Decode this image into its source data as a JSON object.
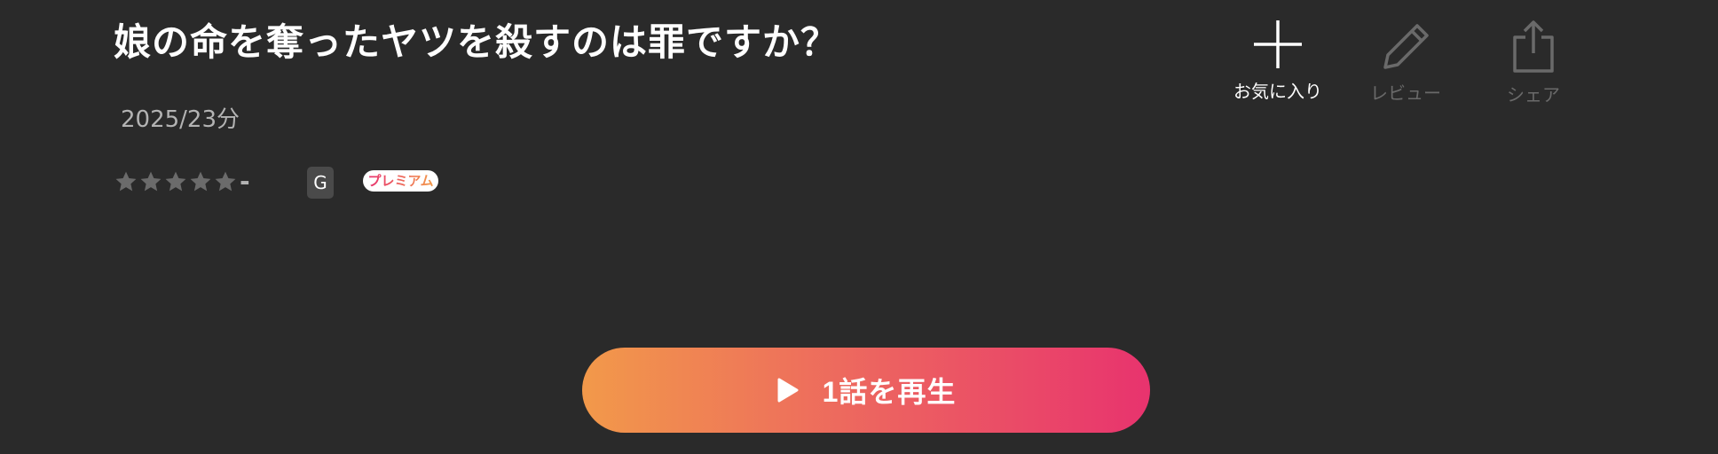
{
  "title": "娘の命を奪ったヤツを殺すのは罪ですか？",
  "meta": "2025/23分",
  "rating": {
    "stars_total": 5,
    "stars_filled": 0,
    "value": "-",
    "star_color": "#6b6b6b"
  },
  "age_rating": "G",
  "premium_label": "プレミアム",
  "premium_gradient": [
    "#f2994a",
    "#e8336e"
  ],
  "actions": {
    "favorite": {
      "label": "お気に入り",
      "icon": "plus-icon",
      "color": "#ffffff"
    },
    "review": {
      "label": "レビュー",
      "icon": "pencil-icon",
      "color": "#6a6a6a"
    },
    "share": {
      "label": "シェア",
      "icon": "share-icon",
      "color": "#6a6a6a"
    }
  },
  "play_button": {
    "label": "1話を再生",
    "icon": "play-icon",
    "gradient": [
      "#f2994a",
      "#e8336e"
    ]
  }
}
